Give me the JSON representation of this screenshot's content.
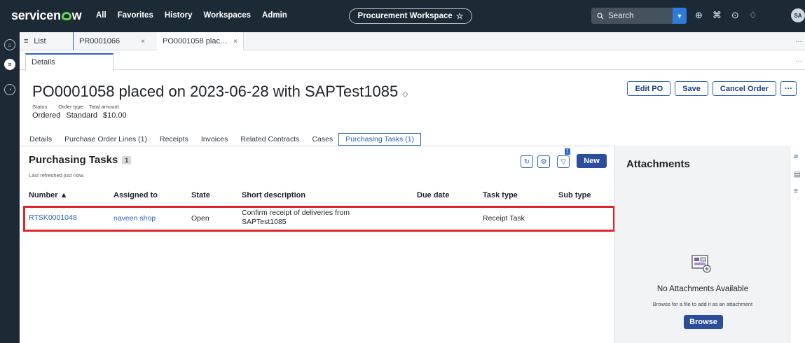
{
  "topbar": {
    "logo_pre": "servicen",
    "logo_post": "w",
    "nav": [
      "All",
      "Favorites",
      "History",
      "Workspaces",
      "Admin"
    ],
    "workspace": "Procurement Workspace",
    "search_label": "Search",
    "avatar_initials": "SA",
    "bg_color": "#1c2a36"
  },
  "tabs": {
    "list": "List",
    "tab1": "PR0001066",
    "tab2": "PO0001058 plac…"
  },
  "subtab": "Details",
  "record": {
    "title": "PO0001058 placed on 2023-06-28 with SAPTest1085",
    "status_label": "Status",
    "order_type_label": "Order type",
    "total_label": "Total amount",
    "status": "Ordered",
    "order_type": "Standard",
    "total": "$10.00"
  },
  "actions": {
    "edit": "Edit PO",
    "save": "Save",
    "cancel": "Cancel Order",
    "more": "···"
  },
  "related_tabs": [
    "Details",
    "Purchase Order Lines (1)",
    "Receipts",
    "Invoices",
    "Related Contracts",
    "Cases",
    "Purchasing Tasks (1)"
  ],
  "list": {
    "title": "Purchasing Tasks",
    "count": "1",
    "refreshed": "Last refreshed just now.",
    "filter_count": "1",
    "new_label": "New",
    "columns": [
      "Number ▲",
      "Assigned to",
      "State",
      "Short description",
      "Due date",
      "Task type",
      "Sub type"
    ],
    "row": {
      "number": "RTSK0001048",
      "assigned_to": "naveen shop",
      "state": "Open",
      "description_line1": "Confirm receipt of deliveries from",
      "description_line2": "SAPTest1085",
      "due_date": "",
      "task_type": "Receipt Task",
      "sub_type": ""
    }
  },
  "attachments": {
    "title": "Attachments",
    "empty": "No Attachments Available",
    "hint": "Browse for a file to add it as an attachment",
    "browse": "Browse"
  },
  "colors": {
    "accent": "#2b62c4",
    "primary_button": "#2b4d9c",
    "highlight_border": "#e2232b"
  }
}
